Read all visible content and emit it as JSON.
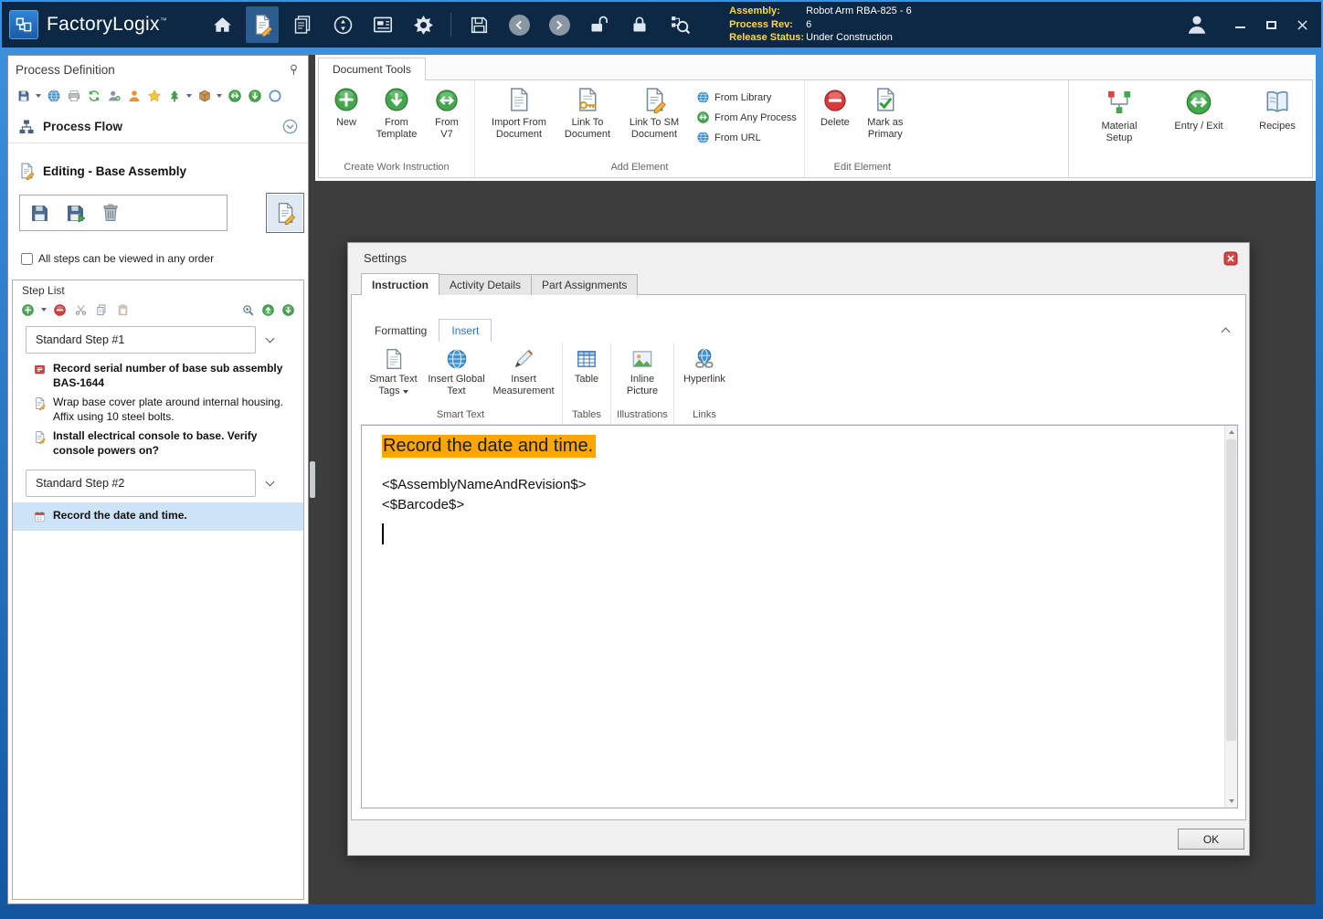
{
  "titlebar": {
    "app_name": "FactoryLogix",
    "trademark": "™",
    "info": {
      "assembly_label": "Assembly:",
      "assembly_value": "Robot Arm RBA-825 - 6",
      "process_rev_label": "Process Rev:",
      "process_rev_value": "6",
      "release_status_label": "Release Status:",
      "release_status_value": "Under Construction"
    }
  },
  "left_panel": {
    "title": "Process Definition",
    "process_flow": "Process Flow",
    "editing_header": "Editing - Base Assembly",
    "order_checkbox": "All steps can be viewed in any order",
    "step_list": {
      "title": "Step List",
      "groups": [
        {
          "label": "Standard Step #1"
        },
        {
          "label": "Standard Step #2"
        }
      ],
      "items": [
        {
          "text": "Record serial number of base sub assembly BAS-1644"
        },
        {
          "text": "Wrap base cover plate around internal housing. Affix using 10 steel bolts."
        },
        {
          "text": "Install electrical console to base. Verify console powers on?"
        },
        {
          "text": "Record the date and time."
        }
      ]
    }
  },
  "ribbon": {
    "tab_label": "Document Tools",
    "create_group": {
      "label": "Create Work Instruction",
      "new": "New",
      "from_template": "From Template",
      "from_v7": "From V7"
    },
    "add_group": {
      "label": "Add Element",
      "import_from_document": "Import From Document",
      "link_to_document": "Link To Document",
      "link_to_sm_document": "Link To SM Document",
      "from_library": "From Library",
      "from_any_process": "From Any Process",
      "from_url": "From URL"
    },
    "edit_group": {
      "label": "Edit Element",
      "delete": "Delete",
      "mark_as_primary": "Mark as Primary"
    },
    "right_buttons": {
      "material_setup": "Material Setup",
      "entry_exit": "Entry / Exit",
      "recipes": "Recipes"
    }
  },
  "dialog": {
    "title": "Settings",
    "tabs": [
      {
        "label": "Instruction"
      },
      {
        "label": "Activity Details"
      },
      {
        "label": "Part Assignments"
      }
    ],
    "inner_tabs": [
      {
        "label": "Formatting"
      },
      {
        "label": "Insert"
      }
    ],
    "insert_ribbon": {
      "smart_text_group_label": "Smart Text",
      "smart_text_tags": "Smart Text Tags",
      "insert_global_text": "Insert Global Text",
      "insert_measurement": "Insert Measurement",
      "tables_group_label": "Tables",
      "table": "Table",
      "illustrations_group_label": "Illustrations",
      "inline_picture": "Inline Picture",
      "links_group_label": "Links",
      "hyperlink": "Hyperlink"
    },
    "editor": {
      "highlighted_line": "Record the date and time.",
      "highlight_color": "#FFA500",
      "line2": "<$AssemblyNameAndRevision$>",
      "line3": "<$Barcode$>"
    },
    "ok_button": "OK"
  }
}
